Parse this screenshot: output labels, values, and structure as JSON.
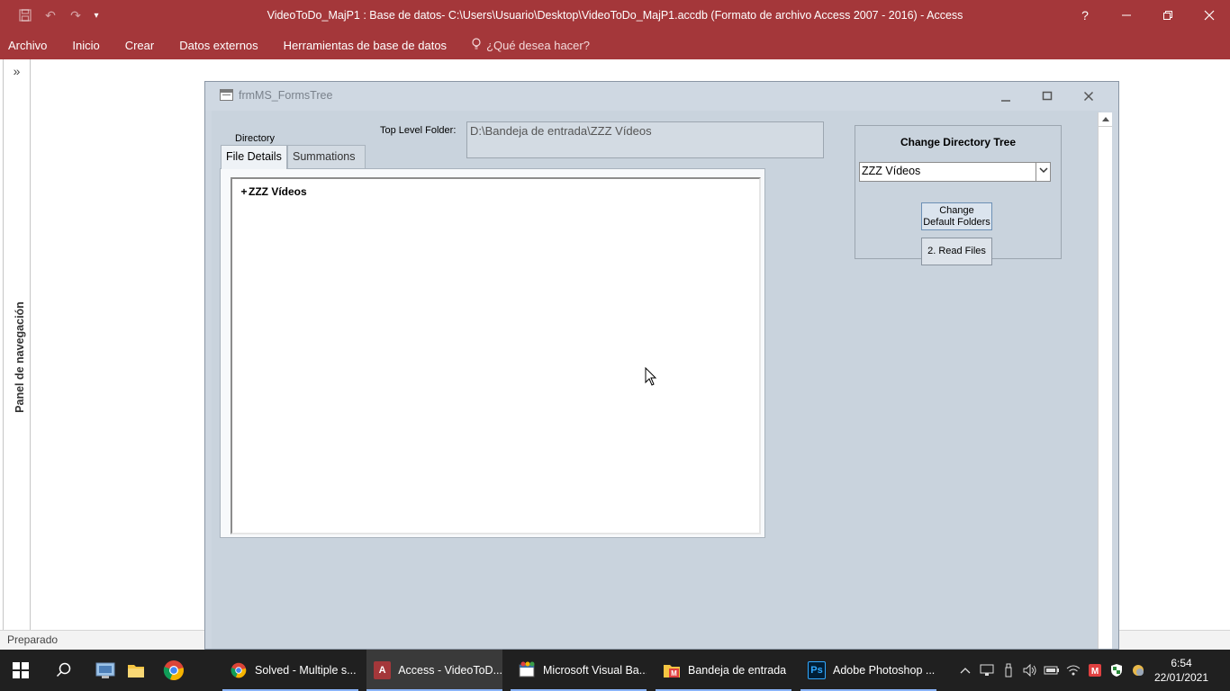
{
  "window": {
    "title": "VideoToDo_MajP1 : Base de datos- C:\\Users\\Usuario\\Desktop\\VideoToDo_MajP1.accdb (Formato de archivo Access 2007 - 2016) - Access",
    "help": "?",
    "minimize": "—",
    "restore": "❐",
    "close": "✕"
  },
  "qat": {
    "save": "🖫",
    "undo": "↶",
    "redo": "↷",
    "customize": "▾"
  },
  "ribbon": {
    "tabs": [
      "Archivo",
      "Inicio",
      "Crear",
      "Datos externos",
      "Herramientas de base de datos"
    ],
    "tell_me_icon": "lightbulb-icon",
    "tell_me": "¿Qué desea hacer?"
  },
  "nav_pane": {
    "toggle": "»",
    "label": "Panel de navegación"
  },
  "status": "Preparado",
  "form": {
    "title": "frmMS_FormsTree",
    "controls": {
      "min": "▁",
      "max": "□",
      "close": "✕"
    },
    "directory_label": "Directory",
    "tabs": [
      "File Details",
      "Summations"
    ],
    "top_level_label": "Top Level Folder:",
    "top_level_value": "D:\\Bandeja de entrada\\ZZZ Vídeos",
    "tree": {
      "expander": "+",
      "root": "ZZZ Vídeos"
    },
    "change_panel": {
      "title": "Change Directory Tree",
      "combo_value": "ZZZ Vídeos",
      "change_btn_line1": "Change",
      "change_btn_line2": "Default Folders",
      "read_btn": "2. Read Files"
    }
  },
  "taskbar": {
    "apps": [
      {
        "label": "Solved - Multiple s...",
        "icon": "chrome-icon",
        "color": "#e0e0e0"
      },
      {
        "label": "Access - VideoToD...",
        "icon": "access-icon",
        "color": "#a4373a"
      },
      {
        "label": "Microsoft Visual Ba...",
        "icon": "vba-icon",
        "color": "#e0e0e0"
      },
      {
        "label": "Bandeja de entrada",
        "icon": "mail-folder-icon",
        "color": "#e8c35a"
      },
      {
        "label": "Adobe Photoshop ...",
        "icon": "photoshop-icon",
        "color": "#001e36"
      }
    ],
    "ps_glyph": "Ps",
    "time": "6:54",
    "date": "22/01/2021"
  }
}
